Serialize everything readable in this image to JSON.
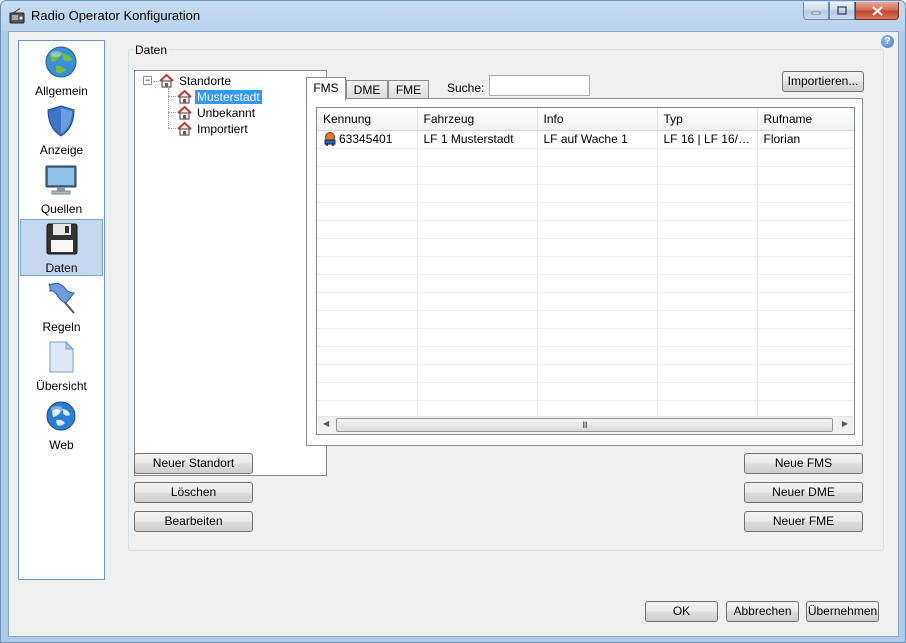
{
  "window": {
    "title": "Radio Operator Konfiguration"
  },
  "nav": {
    "items": [
      {
        "label": "Allgemein",
        "icon": "globe-icon"
      },
      {
        "label": "Anzeige",
        "icon": "shield-icon"
      },
      {
        "label": "Quellen",
        "icon": "monitor-icon"
      },
      {
        "label": "Daten",
        "icon": "floppy-disk-icon",
        "selected": true
      },
      {
        "label": "Regeln",
        "icon": "flag-icon"
      },
      {
        "label": "Übersicht",
        "icon": "document-icon"
      },
      {
        "label": "Web",
        "icon": "web-globe-icon"
      }
    ]
  },
  "group": {
    "label": "Daten"
  },
  "tree": {
    "root": "Standorte",
    "expander": "−",
    "children": [
      "Musterstadt",
      "Unbekannt",
      "Importiert"
    ],
    "selected": "Musterstadt"
  },
  "tabs": [
    "FMS",
    "DME",
    "FME"
  ],
  "search": {
    "label": "Suche:",
    "value": ""
  },
  "grid": {
    "columns": [
      "Kennung",
      "Fahrzeug",
      "Info",
      "Typ",
      "Rufname"
    ],
    "rows": [
      [
        "63345401",
        "LF 1 Musterstadt",
        "LF auf Wache 1",
        "LF 16 | LF 16/12...",
        "Florian"
      ]
    ],
    "scroll_grip": "III"
  },
  "buttons": {
    "importieren": "Importieren...",
    "neuer_standort": "Neuer Standort",
    "loeschen": "Löschen",
    "bearbeiten": "Bearbeiten",
    "neue_fms": "Neue FMS",
    "neuer_dme": "Neuer DME",
    "neuer_fme": "Neuer FME",
    "ok": "OK",
    "abbrechen": "Abbrechen",
    "uebernehmen": "Übernehmen"
  },
  "colors": {
    "selection": "#3399ff",
    "nav_selected": "#c5d6ef",
    "close_button": "#c0432a"
  }
}
